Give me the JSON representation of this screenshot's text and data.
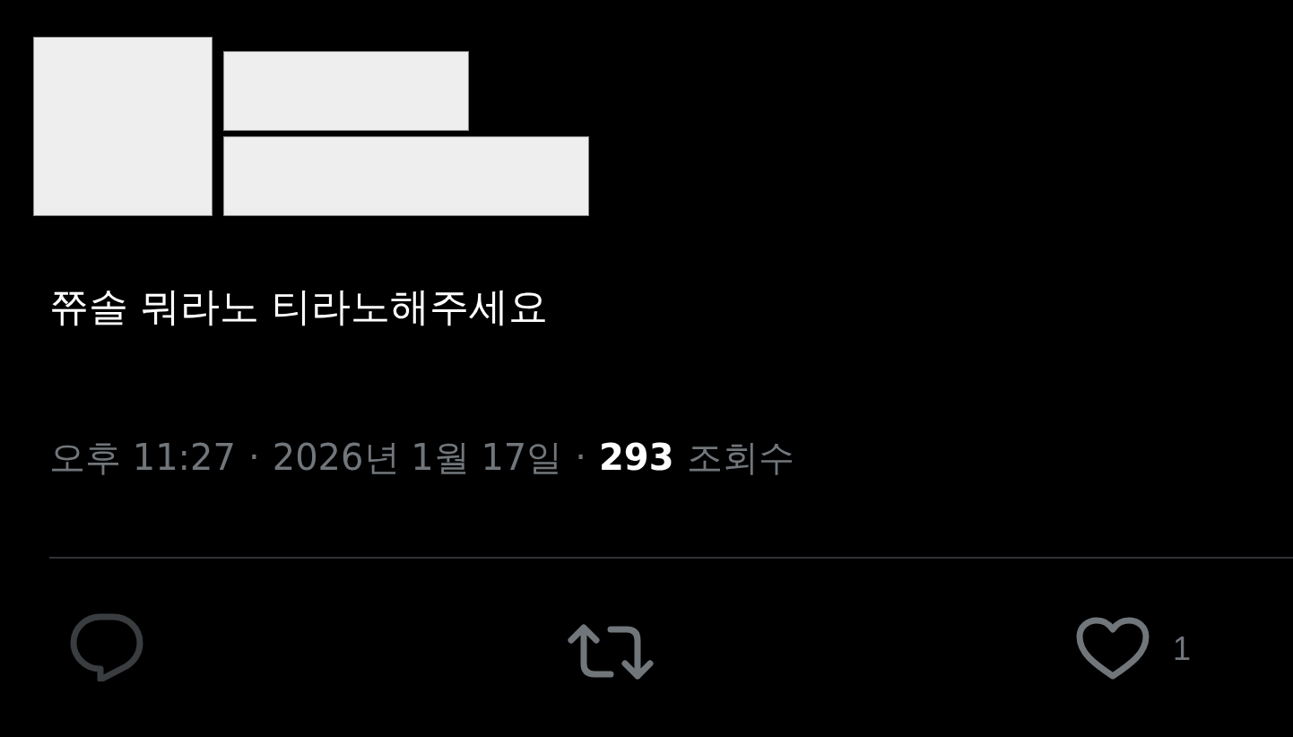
{
  "post": {
    "text": "쮸솔 뭐라노 티라노해주세요"
  },
  "meta": {
    "time": "오후 11:27",
    "separator_1": "·",
    "date": "2026년 1월 17일",
    "separator_2": "·",
    "views_count": "293",
    "views_label": "조회수"
  },
  "actions": [
    {
      "kind": "reply"
    },
    {
      "kind": "repost"
    },
    {
      "kind": "like",
      "count": "1"
    }
  ]
}
